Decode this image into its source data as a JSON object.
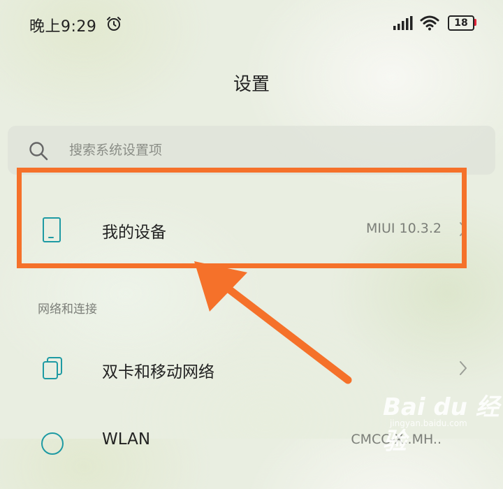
{
  "status_bar": {
    "time": "晚上9:29",
    "battery_level": "18",
    "icons": [
      "alarm-icon",
      "signal-icon",
      "wifi-icon",
      "battery-icon"
    ]
  },
  "header": {
    "title": "设置"
  },
  "search": {
    "placeholder": "搜索系统设置项",
    "icon": "search-icon"
  },
  "my_device": {
    "label": "我的设备",
    "value": "MIUI 10.3.2",
    "icon": "device-icon"
  },
  "sections": [
    {
      "header": "网络和连接",
      "items": [
        {
          "label": "双卡和移动网络",
          "icon": "dual-sim-icon"
        },
        {
          "label": "WLAN",
          "value": "CMCC-X..MH..",
          "icon": "wlan-icon"
        }
      ]
    }
  ],
  "annotation": {
    "highlight_color": "#f5712a"
  },
  "watermark": {
    "logo_text": "Bai du 经验",
    "url": "jingyan.baidu.com"
  },
  "colors": {
    "accent": "#1e9aa3",
    "annotation": "#f5712a"
  }
}
